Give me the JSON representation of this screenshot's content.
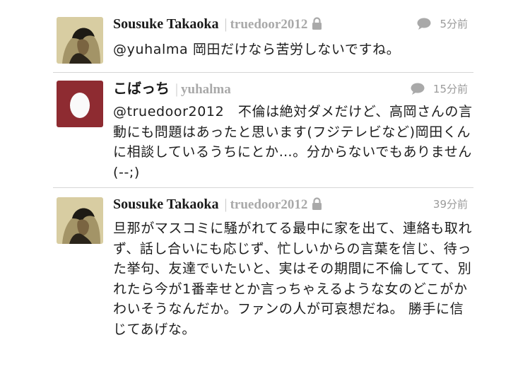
{
  "tweets": [
    {
      "name": "Sousuke Takaoka",
      "handle": "truedoor2012",
      "time": "5分前",
      "text": "@yuhalma 岡田だけなら苦労しないですね。"
    },
    {
      "name": "こばっち",
      "handle": "yuhalma",
      "time": "15分前",
      "text": "@truedoor2012　不倫は絶対ダメだけど、高岡さんの言動にも問題はあったと思います(フジテレビなど)岡田くんに相談しているうちにとか…。分からないでもありません(--;)"
    },
    {
      "name": "Sousuke Takaoka",
      "handle": "truedoor2012",
      "time": "39分前",
      "text": "旦那がマスコミに騒がれてる最中に家を出て、連絡も取れず、話し合いにも応じず、忙しいからの言葉を信じ、待った挙句、友達でいたいと、実はその期間に不倫してて、別れたら今が1番幸せとか言っちゃえるような女のどこがかわいそうなんだか。ファンの人が可哀想だね。 勝手に信じてあげな。"
    }
  ]
}
